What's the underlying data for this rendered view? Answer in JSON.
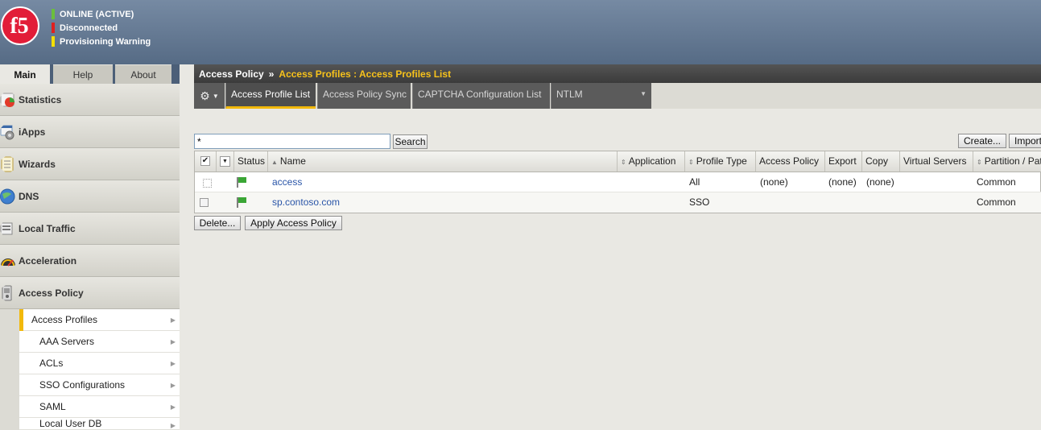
{
  "header": {
    "logo_text": "f5",
    "status": [
      {
        "label": "ONLINE (ACTIVE)",
        "color": "#6bbf3b"
      },
      {
        "label": "Disconnected",
        "color": "#e02020"
      },
      {
        "label": "Provisioning Warning",
        "color": "#f4e000"
      }
    ]
  },
  "tabs": [
    {
      "label": "Main",
      "active": true
    },
    {
      "label": "Help",
      "active": false
    },
    {
      "label": "About",
      "active": false
    }
  ],
  "sidebar": {
    "items": [
      {
        "label": "Statistics",
        "icon": "statistics-icon"
      },
      {
        "label": "iApps",
        "icon": "iapps-icon"
      },
      {
        "label": "Wizards",
        "icon": "wizards-icon"
      },
      {
        "label": "DNS",
        "icon": "dns-icon"
      },
      {
        "label": "Local Traffic",
        "icon": "local-traffic-icon"
      },
      {
        "label": "Acceleration",
        "icon": "acceleration-icon"
      },
      {
        "label": "Access Policy",
        "icon": "access-policy-icon"
      }
    ],
    "subitems": [
      {
        "label": "Access Profiles",
        "active": true
      },
      {
        "label": "AAA Servers"
      },
      {
        "label": "ACLs"
      },
      {
        "label": "SSO Configurations"
      },
      {
        "label": "SAML"
      },
      {
        "label": "Local User DB"
      }
    ]
  },
  "breadcrumb": {
    "section": "Access Policy",
    "separator": "»",
    "current": "Access Profiles : Access Profiles List"
  },
  "toolbar": {
    "tabs": [
      {
        "label": "Access Profile List",
        "active": true
      },
      {
        "label": "Access Policy Sync"
      },
      {
        "label": "CAPTCHA Configuration List"
      },
      {
        "label": "NTLM"
      }
    ]
  },
  "search": {
    "value": "*",
    "button": "Search"
  },
  "actions": {
    "create": "Create...",
    "import": "Import...",
    "delete": "Delete...",
    "apply": "Apply Access Policy"
  },
  "table": {
    "columns": [
      "Status",
      "Name",
      "Application",
      "Profile Type",
      "Access Policy",
      "Export",
      "Copy",
      "Virtual Servers",
      "Partition / Path"
    ],
    "rows": [
      {
        "name": "access",
        "application": "",
        "profile_type": "All",
        "access_policy": "(none)",
        "export": "(none)",
        "copy": "(none)",
        "virtual_servers": "",
        "partition": "Common"
      },
      {
        "name": "sp.contoso.com",
        "application": "",
        "profile_type": "SSO",
        "access_policy": "",
        "export": "",
        "copy": "",
        "virtual_servers": "",
        "partition": "Common"
      }
    ]
  },
  "colors": {
    "accent": "#f2b90b",
    "link": "#2a55a8",
    "header": "#5b6f88"
  }
}
